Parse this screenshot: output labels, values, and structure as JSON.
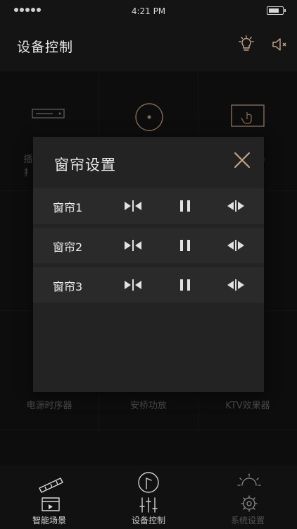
{
  "status_bar": {
    "time": "4:21 PM"
  },
  "header": {
    "title": "设备控制"
  },
  "tiles": {
    "row1": {
      "left_partial": "播扌",
      "right_partial": "。"
    },
    "row3": {
      "left": "电源时序器",
      "center": "安桥功放",
      "right": "KTV效果器"
    }
  },
  "modal": {
    "title": "窗帘设置",
    "curtains": [
      {
        "name": "窗帘1"
      },
      {
        "name": "窗帘2"
      },
      {
        "name": "窗帘3"
      }
    ]
  },
  "bottom_nav": {
    "items": [
      {
        "label": "智能场景",
        "color": "#d9d9d9"
      },
      {
        "label": "设备控制",
        "color": "#c9c9c9"
      },
      {
        "label": "系统设置",
        "color": "#555555"
      }
    ]
  },
  "colors": {
    "accent": "#c7a88a",
    "modal_bg": "#232323",
    "row_bg": "#2a2a2a",
    "page_bg": "#141414"
  }
}
